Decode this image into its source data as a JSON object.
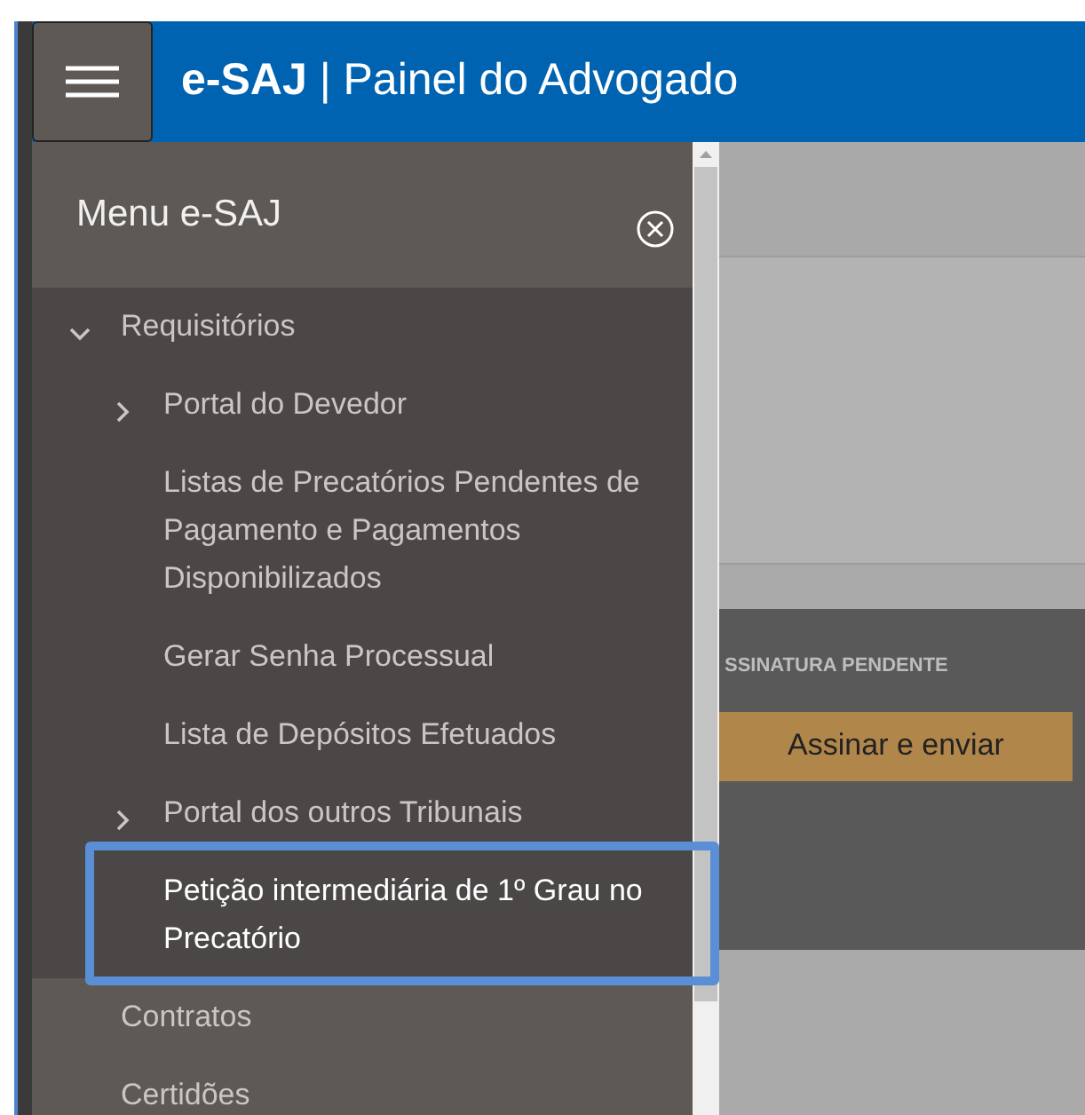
{
  "header": {
    "title": "**e-SAJ** | Painel do Advogado"
  },
  "menu": {
    "title": "Menu e-SAJ",
    "items": [
      {
        "label": "Requisitórios",
        "kind": "group",
        "expanded": true,
        "children": [
          {
            "label": "Portal do Devedor",
            "kind": "group",
            "expanded": false
          },
          {
            "label": "Listas de Precatórios Pendentes de Pagamento e Pagamentos Disponibilizados",
            "kind": "link"
          },
          {
            "label": "Gerar Senha Processual",
            "kind": "link"
          },
          {
            "label": "Lista de Depósitos Efetuados",
            "kind": "link"
          },
          {
            "label": "Portal dos outros Tribunais",
            "kind": "group",
            "expanded": false
          },
          {
            "label": "Petição intermediária de 1º Grau no Precatório",
            "kind": "link",
            "highlighted": true
          }
        ]
      },
      {
        "label": "Contratos",
        "kind": "link"
      },
      {
        "label": "Certidões",
        "kind": "link"
      }
    ]
  },
  "content": {
    "status_label": "SSINATURA PENDENTE",
    "button": "Assinar e enviar"
  }
}
